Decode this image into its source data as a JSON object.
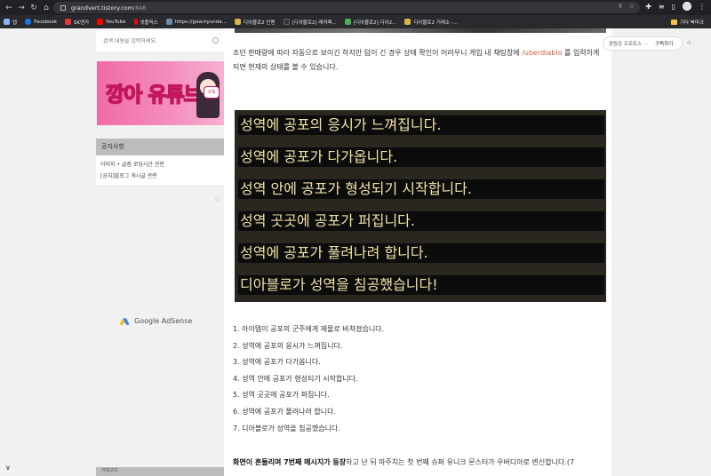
{
  "browser": {
    "url_host": "grandvert.tistory.com",
    "url_path": "/846",
    "bookmarks": [
      {
        "label": "앱",
        "color": "#8ab4f8"
      },
      {
        "label": "Facebook",
        "color": "#1877f2"
      },
      {
        "label": "SK엔카",
        "color": "#e53935"
      },
      {
        "label": "YouTube",
        "color": "#ff0000"
      },
      {
        "label": "넷플릭스",
        "color": "#e50914"
      },
      {
        "label": "https://gow.hyunda...",
        "color": "#6a8caf"
      },
      {
        "label": "디아블로2 인벤",
        "color": "#d9b44a"
      },
      {
        "label": "[디아블로2] 래저렉...",
        "color": "#333333"
      },
      {
        "label": "[디아블로2] 디아2...",
        "color": "#4caf50"
      },
      {
        "label": "디아블로2 거래소 -...",
        "color": "#d9b44a"
      }
    ],
    "other_bookmarks": "기타 북마크"
  },
  "sidebar": {
    "search_placeholder": "검색 내용을 입력하세요.",
    "banner_text": "깡아 유튜브",
    "banner_bubble": "구독",
    "notice_title": "공지사항",
    "notice_links": [
      "이미지 • 글점 로딩시간 관련",
      "[공지]블로그 게시글 관련"
    ],
    "ad_label": "Google AdSense",
    "bottom_title": "카테고리"
  },
  "content": {
    "para_before": "조던 판매량에 따라 자동으로 보이긴 하지만 텀이 긴 경우 상태 확인이 어려우니 게임 내 채팅창에 ",
    "para_highlight": "/uberdiablo",
    "para_after": " 를 입력하게 되면 현재의 상태를 볼 수 있습니다.",
    "game_lines": [
      "성역에 공포의 응시가 느껴집니다.",
      "성역에 공포가 다가옵니다.",
      "성역 안에 공포가 형성되기 시작합니다.",
      "성역 곳곳에 공포가 퍼집니다.",
      "성역에 공포가 풀려나려 합니다.",
      "디아블로가 성역을 침공했습니다!"
    ],
    "list": [
      "1. 아이템이 공포의 군주에게 제물로 바쳐졌습니다.",
      "2. 성역에 공포의 응시가 느껴집니다.",
      "3. 성역에 공포가 다가옵니다.",
      "4. 성역 안에 공포가 형성되기 시작합니다.",
      "5. 성역 곳곳에 공포가 퍼집니다.",
      "6. 성역에 공포가 풀려나려 합니다.",
      "7. 디아블로가 성역을 침공했습니다."
    ],
    "bold_lead": "화면이 흔들리며 7번째 메시지가 등장",
    "bold_rest": "하고 난 뒤 마주치는 첫 번째 슈퍼 유니크 몬스터가 우버디아로 변신합니다.(7"
  },
  "float": {
    "blog_name": "판람존 프로토스 ···",
    "subscribe": "구독하기"
  }
}
